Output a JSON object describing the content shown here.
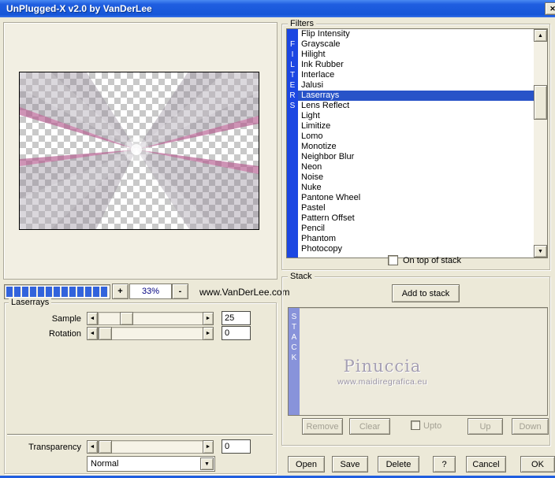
{
  "window": {
    "title": "UnPlugged-X v2.0 by VanDerLee"
  },
  "icons": {
    "close": "✕",
    "slider_left": "◄",
    "slider_right": "►",
    "scroll_up": "▲",
    "scroll_down": "▼",
    "dropdown_arrow": "▼"
  },
  "zoom": {
    "plus_label": "+",
    "level": "33%",
    "minus_label": "-",
    "website": "www.VanDerLee.com"
  },
  "params": {
    "group_label": "Laserrays",
    "sample_label": "Sample",
    "sample_value": "25",
    "rotation_label": "Rotation",
    "rotation_value": "0",
    "transparency_label": "Transparency",
    "transparency_value": "0",
    "blend_mode": "Normal"
  },
  "filters": {
    "group_label": "Filters",
    "vertical_label": "FILTERS",
    "items": [
      "Flip Intensity",
      "Grayscale",
      "Hilight",
      "Ink Rubber",
      "Interlace",
      "Jalusi",
      "Laserrays",
      "Lens Reflect",
      "Light",
      "Limitize",
      "Lomo",
      "Monotize",
      "Neighbor Blur",
      "Neon",
      "Noise",
      "Nuke",
      "Pantone Wheel",
      "Pastel",
      "Pattern Offset",
      "Pencil",
      "Phantom",
      "Photocopy"
    ],
    "selected": "Laserrays",
    "on_top_checkbox_label": "On top of stack"
  },
  "stack": {
    "group_label": "Stack",
    "add_button": "Add to stack",
    "vertical_label": "STACK",
    "watermark_title": "Pinuccia",
    "watermark_url": "www.maidiregrafica.eu",
    "remove_button": "Remove",
    "clear_button": "Clear",
    "upto_checkbox_label": "Upto",
    "up_button": "Up",
    "down_button": "Down"
  },
  "footer": {
    "open_label": "Open",
    "save_label": "Save",
    "delete_label": "Delete",
    "help_label": "?",
    "cancel_label": "Cancel",
    "ok_label": "OK"
  },
  "colors": {
    "titlebar_blue": "#1F5EE0",
    "selection_blue": "#2853C8",
    "filters_bar_blue": "#1C47E2",
    "stack_bar_periwinkle": "#8893DA",
    "progress_blue": "#3263DC",
    "ray_pink": "#B4598E"
  }
}
